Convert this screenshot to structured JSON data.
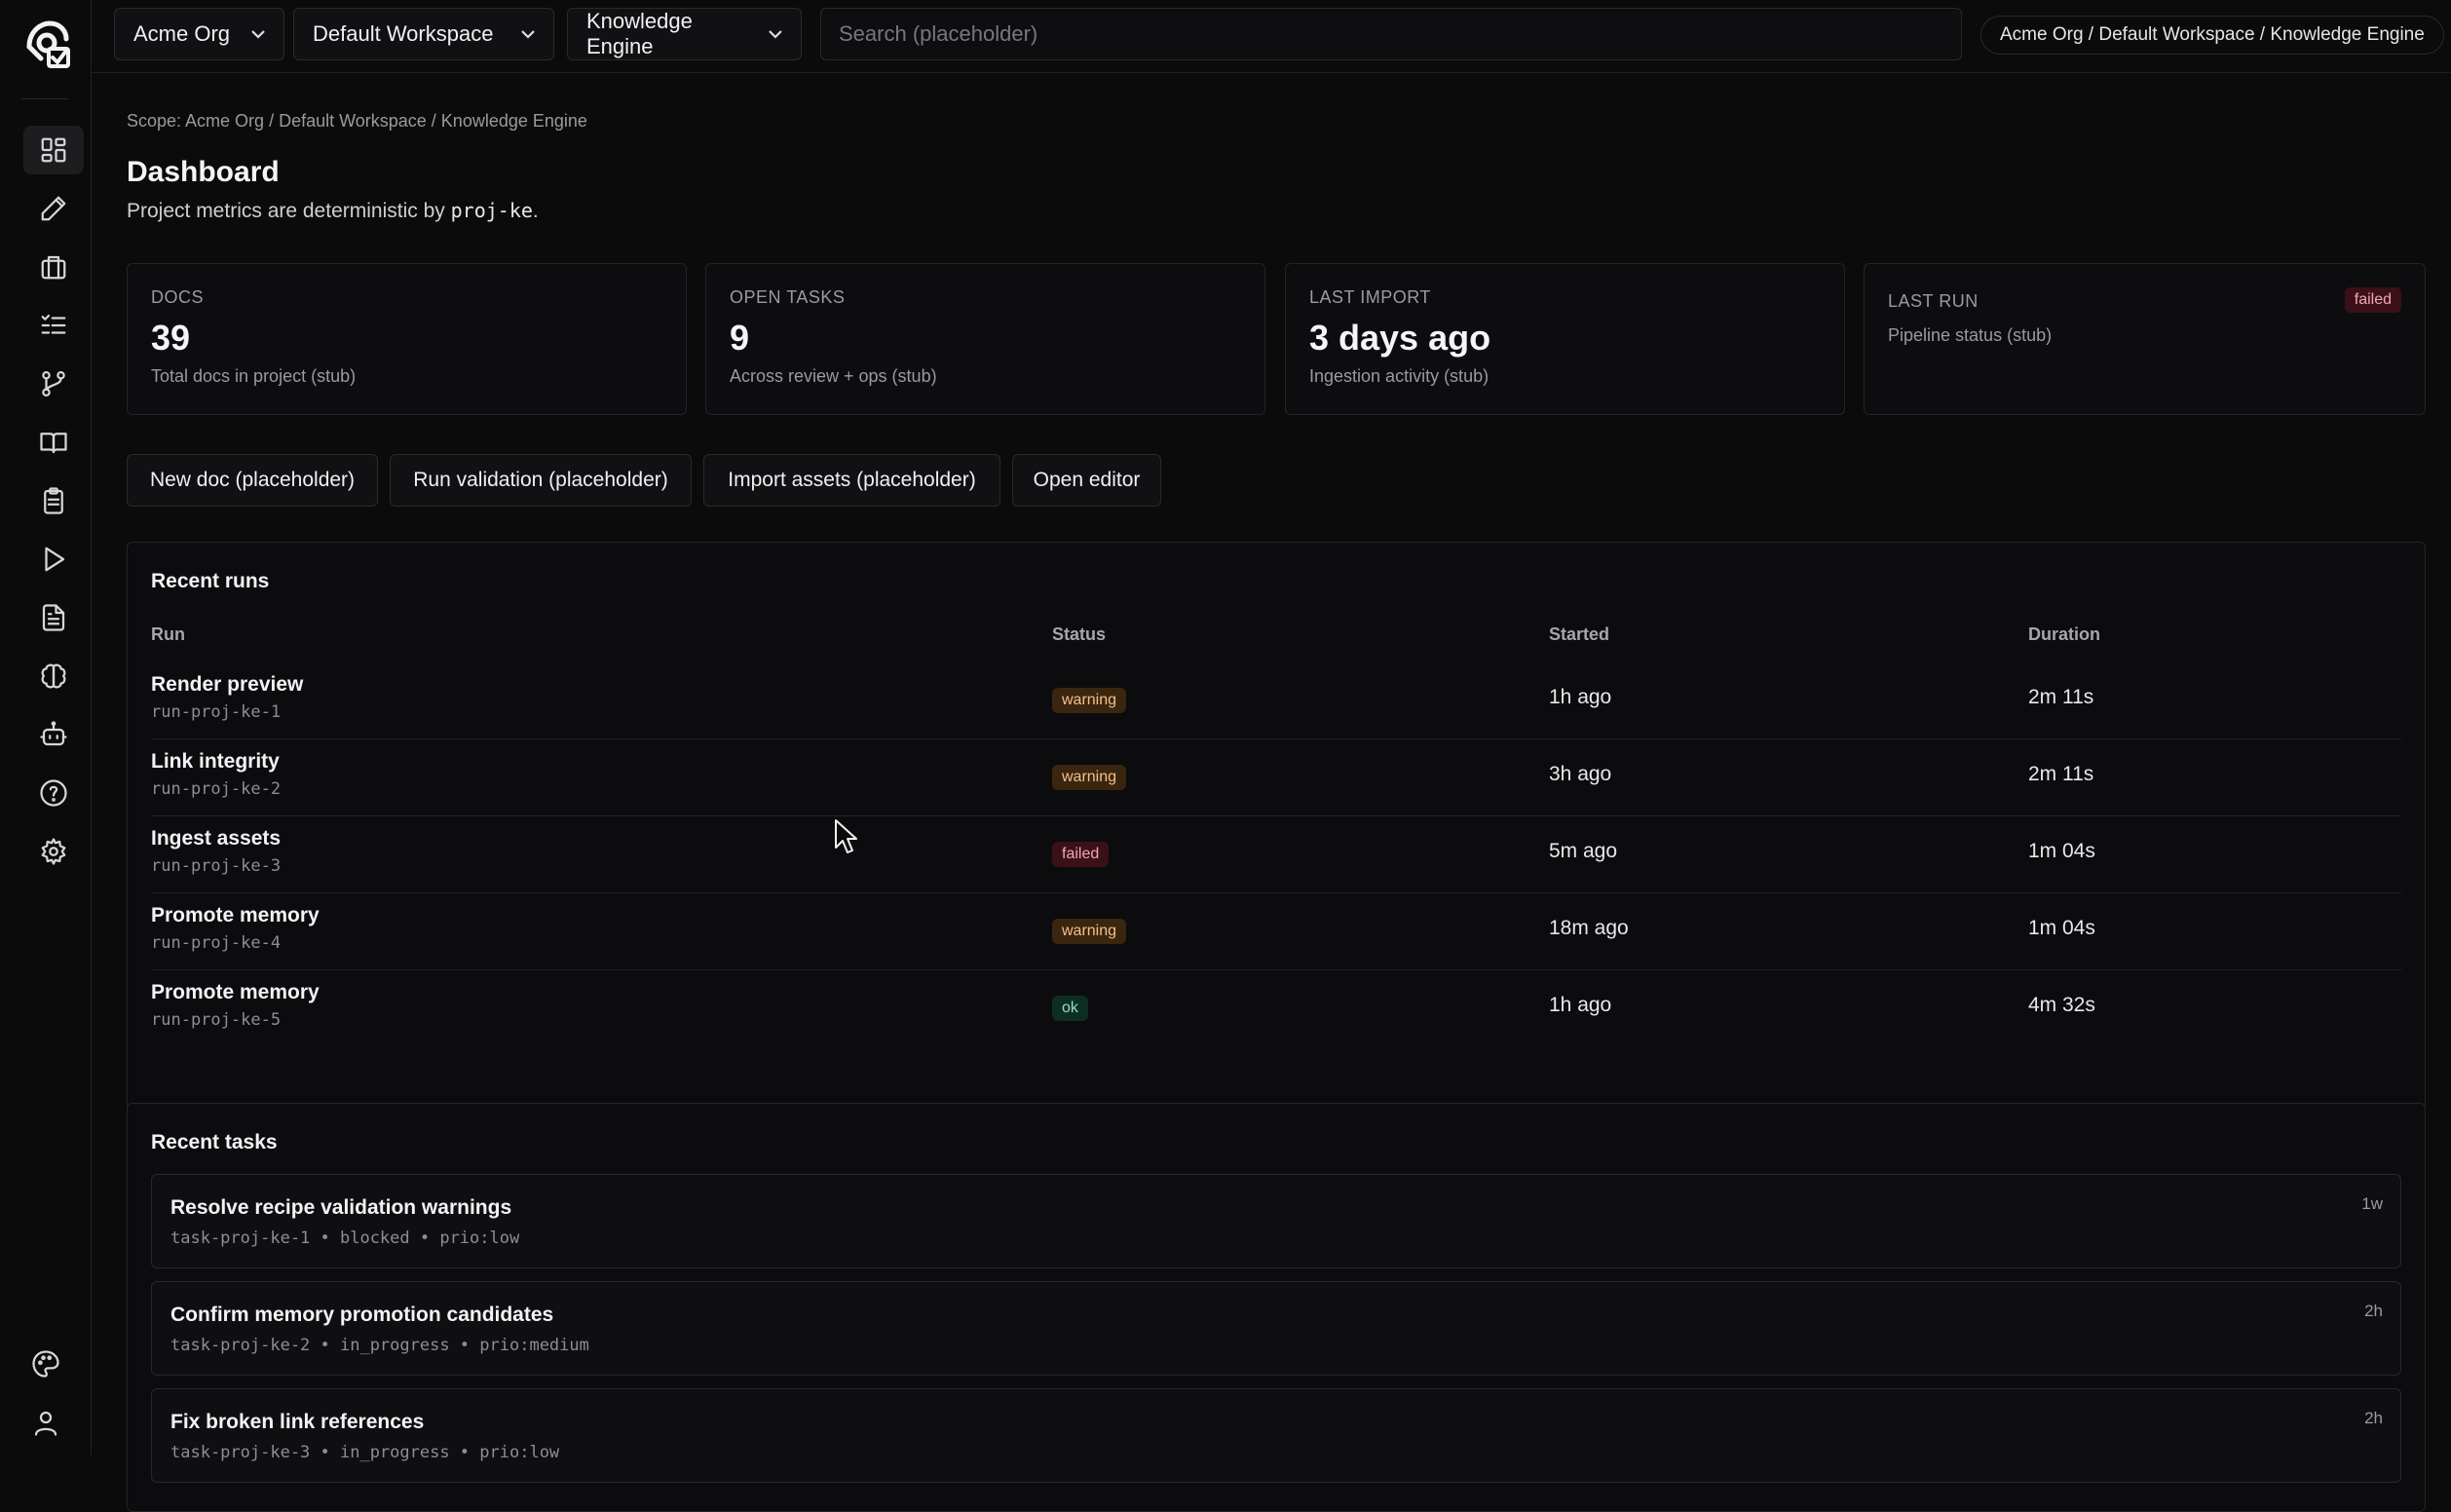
{
  "topbar": {
    "org": "Acme Org",
    "workspace": "Default Workspace",
    "project": "Knowledge Engine",
    "search_placeholder": "Search (placeholder)",
    "breadcrumb": "Acme Org / Default Workspace / Knowledge Engine"
  },
  "sidebar": {
    "items": [
      {
        "icon": "dashboard-icon",
        "active": true
      },
      {
        "icon": "pencil-icon"
      },
      {
        "icon": "briefcase-icon"
      },
      {
        "icon": "checklist-icon"
      },
      {
        "icon": "git-branch-icon"
      },
      {
        "icon": "book-icon"
      },
      {
        "icon": "clipboard-icon"
      },
      {
        "icon": "play-icon"
      },
      {
        "icon": "document-icon"
      },
      {
        "icon": "brain-icon"
      },
      {
        "icon": "bot-icon"
      },
      {
        "icon": "help-icon"
      },
      {
        "icon": "settings-icon"
      }
    ],
    "bottom": [
      {
        "icon": "palette-icon"
      },
      {
        "icon": "user-icon"
      }
    ]
  },
  "page": {
    "scope": "Scope: Acme Org / Default Workspace / Knowledge Engine",
    "title": "Dashboard",
    "subtitle_prefix": "Project metrics are deterministic by ",
    "subtitle_code": "proj-ke",
    "subtitle_suffix": "."
  },
  "metrics": [
    {
      "label": "DOCS",
      "value": "39",
      "sub": "Total docs in project (stub)"
    },
    {
      "label": "OPEN TASKS",
      "value": "9",
      "sub": "Across review + ops (stub)"
    },
    {
      "label": "LAST IMPORT",
      "value": "3 days ago",
      "sub": "Ingestion activity (stub)"
    },
    {
      "label": "LAST RUN",
      "sub": "Pipeline status (stub)",
      "badge": "failed"
    }
  ],
  "actions": {
    "new_doc": "New doc (placeholder)",
    "run_validation": "Run validation (placeholder)",
    "import_assets": "Import assets (placeholder)",
    "open_editor": "Open editor"
  },
  "runs": {
    "title": "Recent runs",
    "headers": {
      "run": "Run",
      "status": "Status",
      "started": "Started",
      "duration": "Duration"
    },
    "rows": [
      {
        "name": "Render preview",
        "id": "run-proj-ke-1",
        "status": "warning",
        "started": "1h ago",
        "duration": "2m 11s"
      },
      {
        "name": "Link integrity",
        "id": "run-proj-ke-2",
        "status": "warning",
        "started": "3h ago",
        "duration": "2m 11s"
      },
      {
        "name": "Ingest assets",
        "id": "run-proj-ke-3",
        "status": "failed",
        "started": "5m ago",
        "duration": "1m 04s"
      },
      {
        "name": "Promote memory",
        "id": "run-proj-ke-4",
        "status": "warning",
        "started": "18m ago",
        "duration": "1m 04s"
      },
      {
        "name": "Promote memory",
        "id": "run-proj-ke-5",
        "status": "ok",
        "started": "1h ago",
        "duration": "4m 32s"
      }
    ]
  },
  "tasks": {
    "title": "Recent tasks",
    "items": [
      {
        "title": "Resolve recipe validation warnings",
        "meta": "task-proj-ke-1 • blocked • prio:low",
        "age": "1w"
      },
      {
        "title": "Confirm memory promotion candidates",
        "meta": "task-proj-ke-2 • in_progress • prio:medium",
        "age": "2h"
      },
      {
        "title": "Fix broken link references",
        "meta": "task-proj-ke-3 • in_progress • prio:low",
        "age": "2h"
      }
    ]
  },
  "colors": {
    "failed": "#f3a6b4",
    "warning": "#f4c08c",
    "ok": "#8fe0bb"
  }
}
